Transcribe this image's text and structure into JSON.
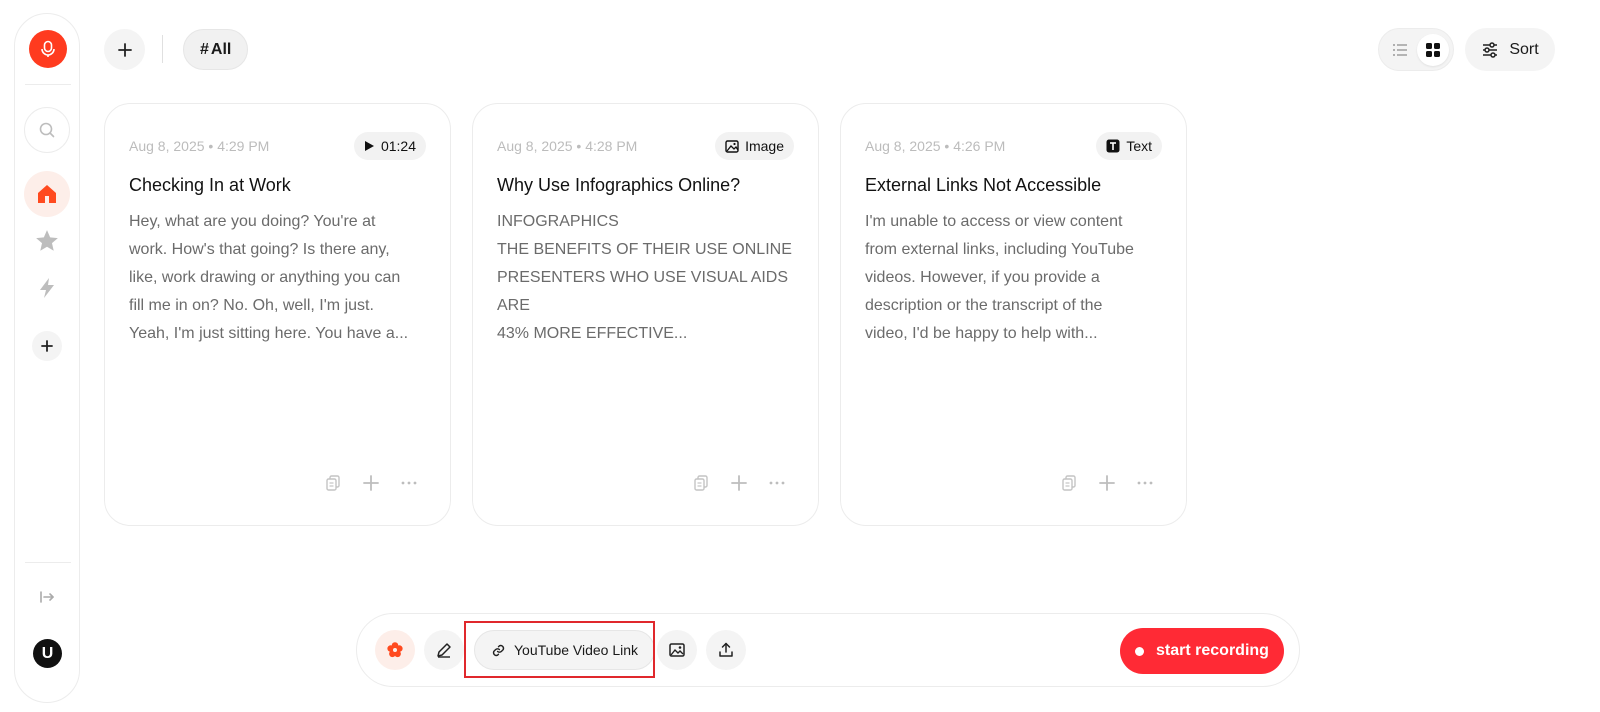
{
  "sidebar": {
    "avatar_initial": "U",
    "items": [
      {
        "name": "home",
        "active": true
      },
      {
        "name": "favorites",
        "active": false
      },
      {
        "name": "actions",
        "active": false
      }
    ]
  },
  "topbar": {
    "tag_hash": "#",
    "tag_label": "All",
    "sort_label": "Sort",
    "view_mode": "grid"
  },
  "cards": [
    {
      "date": "Aug 8, 2025 • 4:29 PM",
      "badge_type": "audio",
      "badge_label": "01:24",
      "title": "Checking In at Work",
      "lines": [
        "Hey, what are you doing? You're at",
        "work. How's that going? Is there any,",
        "like, work drawing or anything you can",
        "fill me in on? No. Oh, well, I'm just.",
        "Yeah, I'm just sitting here. You have a..."
      ]
    },
    {
      "date": "Aug 8, 2025 • 4:28 PM",
      "badge_type": "image",
      "badge_label": "Image",
      "title": "Why Use Infographics Online?",
      "lines": [
        "INFOGRAPHICS",
        "THE BENEFITS OF THEIR USE ONLINE",
        "PRESENTERS WHO USE VISUAL AIDS",
        "ARE",
        "43% MORE EFFECTIVE..."
      ]
    },
    {
      "date": "Aug 8, 2025 • 4:26 PM",
      "badge_type": "text",
      "badge_label": "Text",
      "title": "External Links Not Accessible",
      "lines": [
        "I'm unable to access or view content",
        "from external links, including YouTube",
        "videos. However, if you provide a",
        "description or the transcript of the",
        "video, I'd be happy to help with..."
      ]
    }
  ],
  "toolbar": {
    "youtube_label": "YouTube Video Link",
    "record_label": "start recording"
  },
  "colors": {
    "accent": "#ff3b1f",
    "record": "#ff2a35",
    "highlight": "#e0282c"
  }
}
